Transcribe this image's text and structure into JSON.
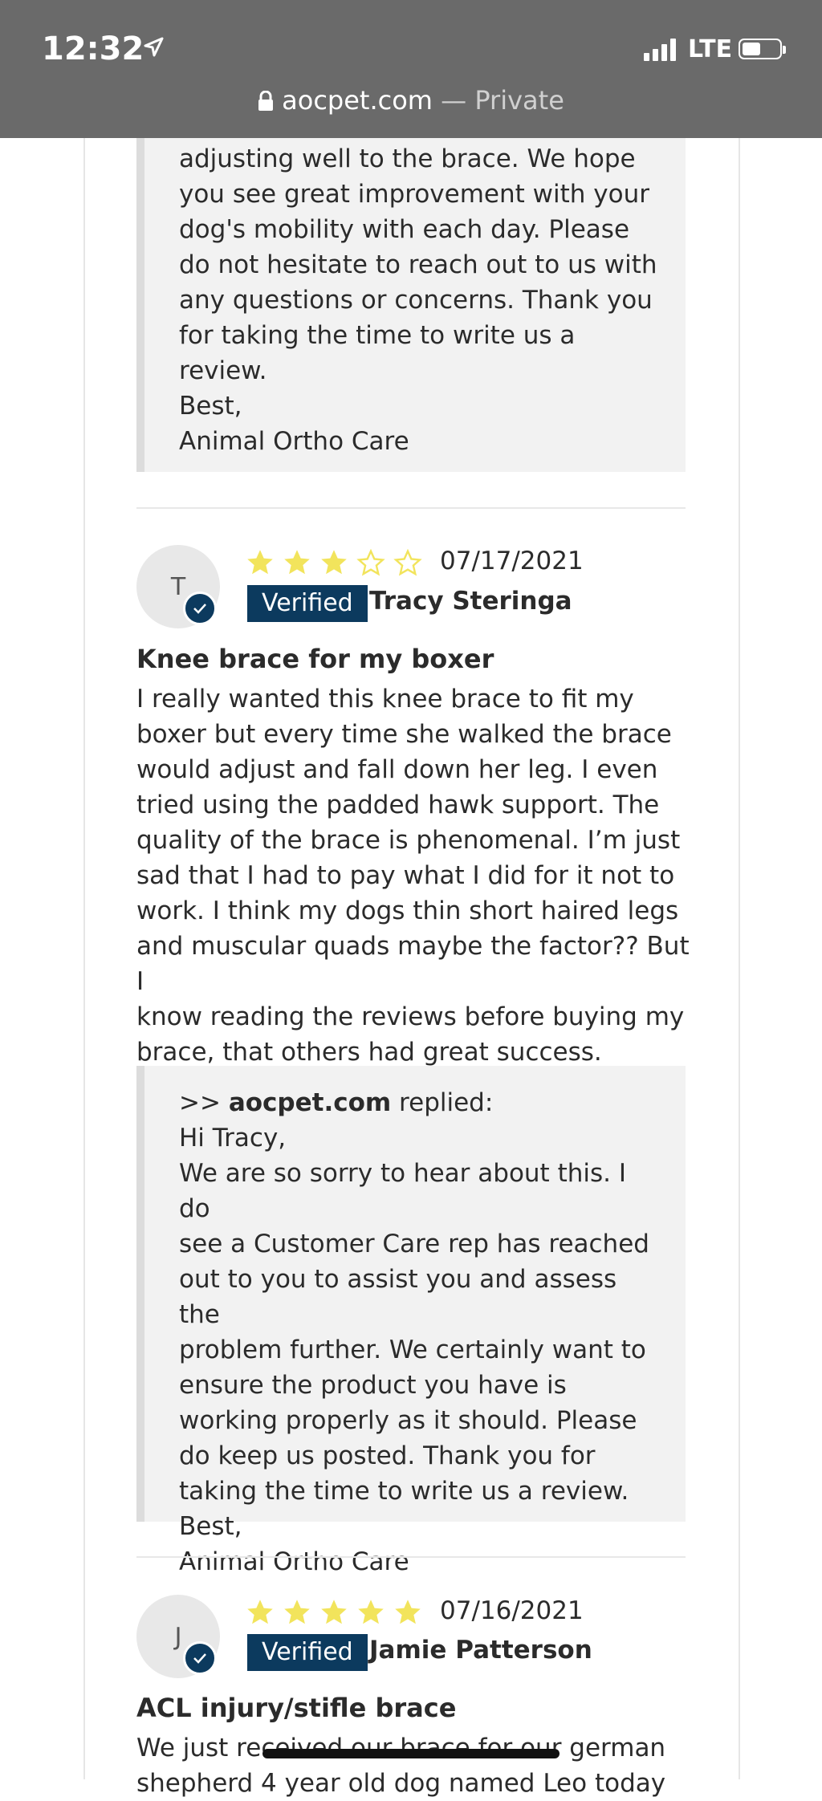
{
  "status_bar": {
    "time": "12:32",
    "network": "LTE"
  },
  "address_bar": {
    "domain": "aocpet.com",
    "separator": " — ",
    "mode": "Private"
  },
  "colors": {
    "star": "#f2e45c",
    "verified_bg": "#0c3a5e",
    "reply_bg": "#f2f2f2",
    "topbar_bg": "#6a6a6a"
  },
  "previous_reply_tail": {
    "lines": [
      "adjusting well to the brace. We hope",
      "you see great improvement with your",
      "dog's mobility with each day. Please",
      "do not hesitate to reach out to us with",
      "any questions or concerns. Thank you",
      "for taking the time to write us a",
      "review.",
      "Best,",
      "Animal Ortho Care"
    ]
  },
  "reviews": [
    {
      "initial": "T",
      "rating": 3,
      "max_rating": 5,
      "date": "07/17/2021",
      "verified_label": "Verified",
      "reviewer": "Tracy Steringa",
      "title": "Knee brace for my boxer",
      "body_lines": [
        "I really wanted this knee brace to fit my",
        "boxer but every time she walked the brace",
        "would adjust and fall down her leg. I even",
        "tried using the padded hawk support. The",
        "quality of the brace is phenomenal. I’m just",
        "sad that I had to pay what I did for it not to",
        "work. I think my dogs thin short haired legs",
        "and muscular quads maybe the factor?? But I",
        "know reading the reviews before buying my",
        "brace, that others had great success."
      ],
      "reply": {
        "prefix": ">> ",
        "author": "aocpet.com",
        "suffix": " replied:",
        "lines": [
          "Hi Tracy,",
          "We are so sorry to hear about this. I do",
          "see a Customer Care rep has reached",
          "out to you to assist you and assess the",
          "problem further. We certainly want to",
          "ensure the product you have is",
          "working properly as it should. Please",
          "do keep us posted. Thank you for",
          "taking the time to write us a review.",
          "Best,",
          "Animal Ortho Care"
        ]
      }
    },
    {
      "initial": "J",
      "rating": 5,
      "max_rating": 5,
      "date": "07/16/2021",
      "verified_label": "Verified",
      "reviewer": "Jamie Patterson",
      "title": "ACL injury/stifle brace",
      "body_lines": [
        "We just received our brace for our german",
        "shepherd 4 year old dog named Leo today"
      ]
    }
  ]
}
